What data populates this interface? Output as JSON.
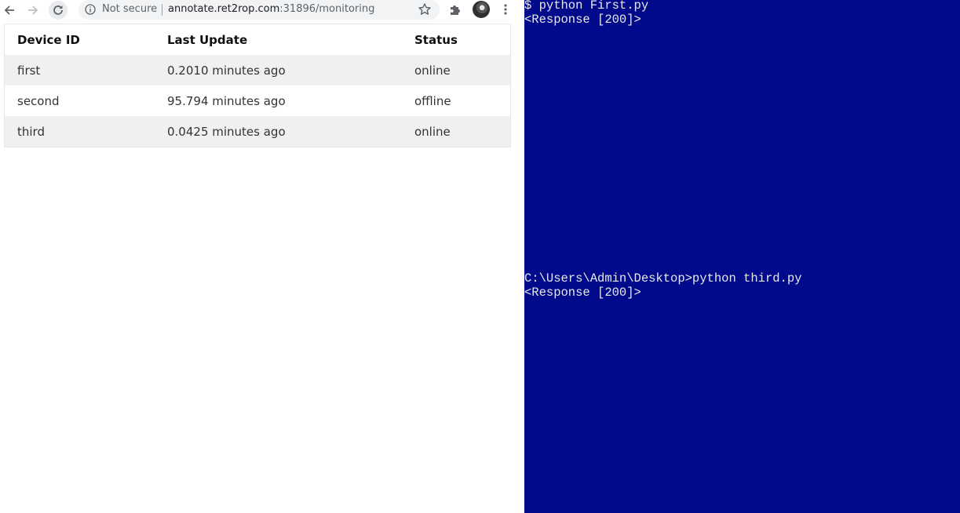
{
  "browser": {
    "security_label": "Not secure",
    "url_host": "annotate.ret2rop.com",
    "url_rest": ":31896/monitoring"
  },
  "table": {
    "headers": [
      "Device ID",
      "Last Update",
      "Status"
    ],
    "rows": [
      {
        "device_id": "first",
        "last_update": "0.2010 minutes ago",
        "status": "online"
      },
      {
        "device_id": "second",
        "last_update": "95.794 minutes ago",
        "status": "offline"
      },
      {
        "device_id": "third",
        "last_update": "0.0425 minutes ago",
        "status": "online"
      }
    ]
  },
  "colors": {
    "online": "#3a8a3a",
    "offline": "#e04040",
    "console_background": "#000a8a"
  },
  "console": {
    "lines": [
      "$ python First.py",
      "<Response [200]>",
      "C:\\Users\\Admin\\Desktop>python third.py",
      "<Response [200]>"
    ]
  },
  "icons": [
    "back-arrow-icon",
    "forward-arrow-icon",
    "reload-icon",
    "info-icon",
    "star-icon",
    "puzzle-icon",
    "kebab-menu-icon"
  ]
}
